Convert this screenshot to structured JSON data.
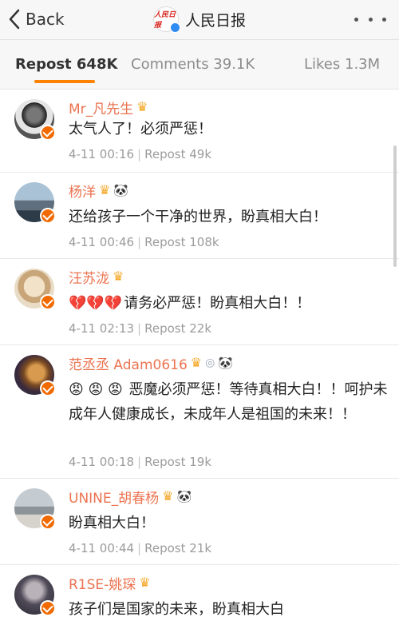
{
  "nav": {
    "back_label": "Back",
    "account_name": "人民日报",
    "account_logo_text": "人民日报"
  },
  "tabs": [
    {
      "label": "Repost 648K",
      "active": true
    },
    {
      "label": "Comments 39.1K",
      "active": false
    },
    {
      "label": "Likes 1.3M",
      "active": false
    }
  ],
  "reposts": [
    {
      "username": "Mr_凡先生",
      "badges": [
        "crown-icon"
      ],
      "text": "太气人了！必须严惩！",
      "time": "4-11 00:16",
      "repost": "Repost 49k"
    },
    {
      "username": "杨洋",
      "badges": [
        "crown-icon",
        "panda-icon"
      ],
      "text": "还给孩子一个干净的世界，盼真相大白！",
      "time": "4-11 00:46",
      "repost": "Repost 108k"
    },
    {
      "username": "汪苏泷",
      "badges": [
        "crown-icon"
      ],
      "emoji": "💔💔💔",
      "text": "请务必严惩！盼真相大白！！",
      "time": "4-11 02:13",
      "repost": "Repost 22k"
    },
    {
      "username": "范丞丞 Adam0616",
      "badges": [
        "crown-icon",
        "medal-icon",
        "panda-icon"
      ],
      "emoji": "😡 😡 😡",
      "text": " 恶魔必须严惩！等待真相大白！！呵护未成年人健康成长，未成年人是祖国的未来！！",
      "time": "4-11 00:18",
      "repost": "Repost 19k"
    },
    {
      "username": "UNINE_胡春杨",
      "badges": [
        "crown-icon",
        "panda-icon"
      ],
      "text": "盼真相大白！",
      "time": "4-11 00:44",
      "repost": "Repost 21k"
    },
    {
      "username": "R1SE-姚琛",
      "badges": [
        "crown-icon"
      ],
      "text": "孩子们是国家的未来，盼真相大白",
      "time": "",
      "repost": ""
    }
  ],
  "meta_separator": "|",
  "colors": {
    "username": "#eb7350",
    "tab_indicator": "#ff8200",
    "verified_badge": "#f16a00",
    "meta_text": "#9b9b9b"
  }
}
